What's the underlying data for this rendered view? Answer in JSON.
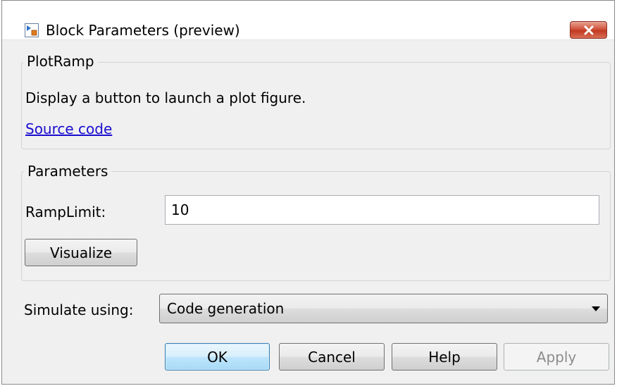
{
  "window": {
    "title": "Block Parameters (preview)",
    "icons": {
      "app": "simulink-block-icon",
      "close": "close-icon"
    },
    "colors": {
      "close_button": "#c94a33",
      "link": "#1a0dcf",
      "default_button_border": "#3c7fb1"
    }
  },
  "description_group": {
    "title": "PlotRamp",
    "description": "Display a button to launch a plot figure.",
    "link_label": "Source code"
  },
  "parameters_group": {
    "title": "Parameters",
    "ramp_limit_label": "RampLimit:",
    "ramp_limit_value": "10",
    "visualize_label": "Visualize"
  },
  "simulate": {
    "label": "Simulate using:",
    "selected": "Code generation"
  },
  "buttons": {
    "ok": "OK",
    "cancel": "Cancel",
    "help": "Help",
    "apply": "Apply"
  }
}
